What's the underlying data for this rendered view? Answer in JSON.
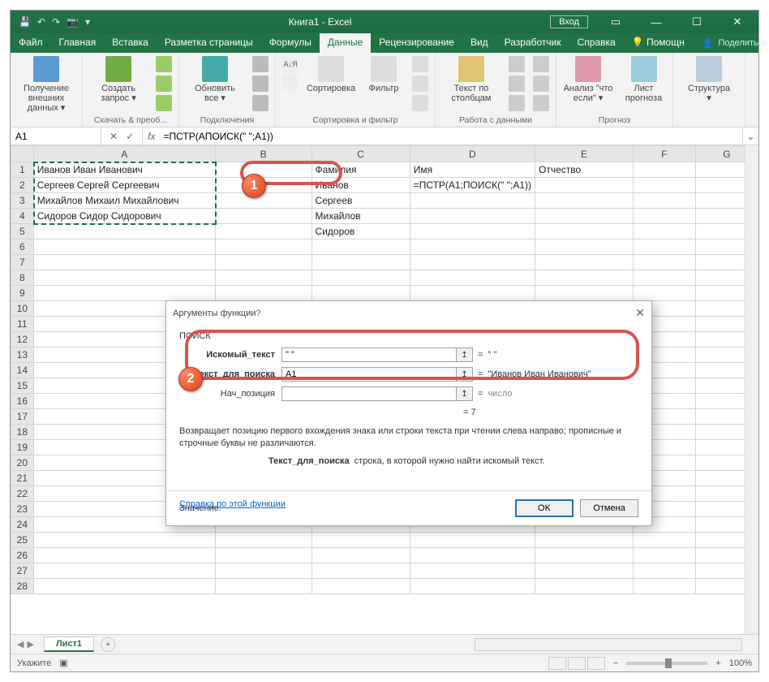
{
  "titlebar": {
    "title": "Книга1 - Excel",
    "login": "Вход"
  },
  "tabs": [
    "Файл",
    "Главная",
    "Вставка",
    "Разметка страницы",
    "Формулы",
    "Данные",
    "Рецензирование",
    "Вид",
    "Разработчик",
    "Справка",
    "Помощн"
  ],
  "active_tab": 5,
  "share": "Поделиться",
  "ribbon": {
    "g1": {
      "big": "Получение\nвнешних данных ▾"
    },
    "g2": {
      "big": "Создать\nзапрос ▾",
      "label": "Скачать & преоб..."
    },
    "g3": {
      "big": "Обновить\nвсе ▾",
      "label": "Подключения"
    },
    "g4": {
      "sort_az": "А↓Я",
      "sort": "Сортировка",
      "filter": "Фильтр",
      "label": "Сортировка и фильтр"
    },
    "g5": {
      "big": "Текст по\nстолбцам",
      "label": "Работа с данными"
    },
    "g6": {
      "a": "Анализ \"что\nесли\" ▾",
      "b": "Лист\nпрогноза",
      "label": "Прогноз"
    },
    "g7": {
      "big": "Структура\n▾"
    }
  },
  "fbar": {
    "name": "A1",
    "formula_pre": "=ПСТР(A",
    "formula_hl": "ПОИСК(",
    "formula_post": "\" \";A1))"
  },
  "cols": [
    "A",
    "B",
    "C",
    "D",
    "E",
    "F",
    "G"
  ],
  "rows": {
    "1": {
      "A": "Иванов Иван Иванович",
      "C": "Фамилия",
      "D": "Имя",
      "E": "Отчество"
    },
    "2": {
      "A": "Сергеев Сергей Сергеевич",
      "C": "Иванов",
      "D": "=ПСТР(A1;ПОИСК(\" \";A1))"
    },
    "3": {
      "A": "Михайлов Михаил Михайлович",
      "C": "Сергеев"
    },
    "4": {
      "A": "Сидоров Сидор Сидорович",
      "C": "Михайлов"
    },
    "5": {
      "C": "Сидоров"
    }
  },
  "dialog": {
    "title": "Аргументы функции",
    "fname": "ПОИСК",
    "arg1": {
      "label": "Искомый_текст",
      "value": "\" \"",
      "preview": "\" \""
    },
    "arg2": {
      "label": "Текст_для_поиска",
      "value": "A1",
      "preview": "\"Иванов Иван Иванович\""
    },
    "arg3": {
      "label": "Нач_позиция",
      "value": "",
      "preview": "число"
    },
    "result_eq": "= 7",
    "desc": "Возвращает позицию первого вхождения знака или строки текста при чтении слева направо; прописные и строчные буквы не различаются.",
    "argdesc_label": "Текст_для_поиска",
    "argdesc_text": "строка, в которой нужно найти искомый текст.",
    "value_label": "Значение:",
    "help": "Справка по этой функции",
    "ok": "OK",
    "cancel": "Отмена"
  },
  "sheet": {
    "name": "Лист1"
  },
  "status": {
    "left": "Укажите",
    "zoom": "100%"
  },
  "callouts": {
    "n1": "1",
    "n2": "2"
  }
}
